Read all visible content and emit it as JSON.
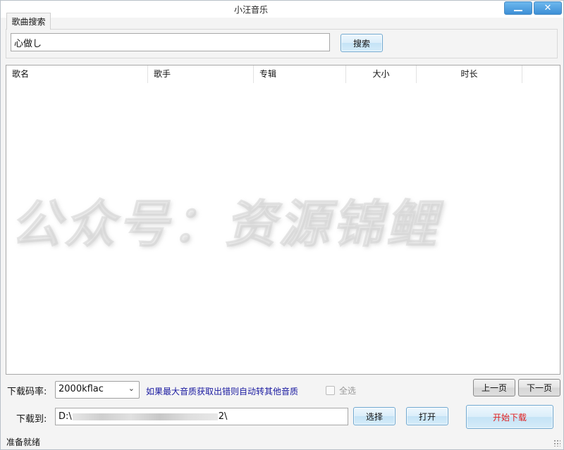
{
  "window": {
    "title": "小汪音乐",
    "minimize_icon": "minimize-icon",
    "close_icon": "close-icon",
    "close_label": "✕"
  },
  "tab": {
    "label": "歌曲搜索"
  },
  "search": {
    "value": "心做し",
    "button_label": "搜索"
  },
  "table": {
    "columns": [
      "歌名",
      "歌手",
      "专辑",
      "大小",
      "时长"
    ],
    "rows": []
  },
  "watermark": "公众号：资源锦鲤",
  "bitrate": {
    "label": "下载码率:",
    "selected": "2000kflac",
    "arrow_icon": "chevron-down-icon"
  },
  "hint": "如果最大音质获取出错则自动转其他音质",
  "select_all": {
    "label": "全选",
    "checked": false
  },
  "pagination": {
    "prev_label": "上一页",
    "next_label": "下一页"
  },
  "download": {
    "label": "下载到:",
    "path_prefix": "D:\\",
    "path_suffix": "2\\",
    "choose_label": "选择",
    "open_label": "打开",
    "start_label": "开始下载",
    "start_color": "#e02020"
  },
  "status": {
    "text": "准备就绪"
  },
  "colors": {
    "accent": "#4a8bc2",
    "hint": "#1a1aa0"
  }
}
